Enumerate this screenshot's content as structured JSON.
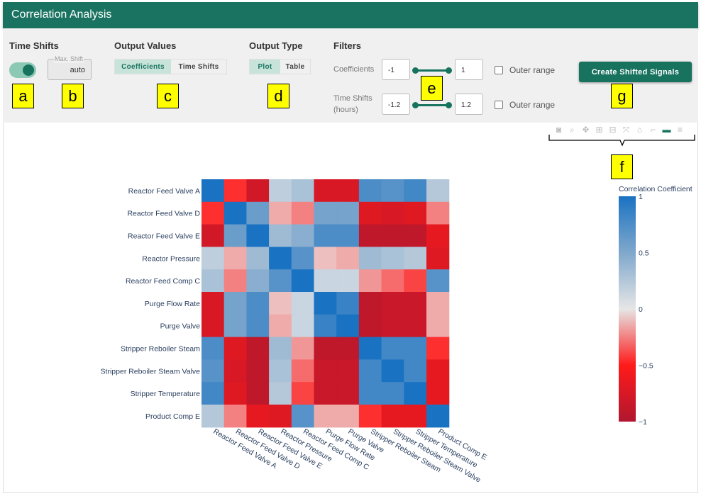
{
  "header": {
    "title": "Correlation Analysis"
  },
  "controls": {
    "time_shifts": {
      "title": "Time Shifts",
      "toggle_on": true,
      "max_shift_label": "Max. Shift",
      "max_shift_value": "auto"
    },
    "output_values": {
      "title": "Output Values",
      "options": [
        "Coefficients",
        "Time Shifts"
      ],
      "selected": "Coefficients"
    },
    "output_type": {
      "title": "Output Type",
      "options": [
        "Plot",
        "Table"
      ],
      "selected": "Plot"
    },
    "filters": {
      "title": "Filters",
      "coefficients": {
        "label": "Coefficients",
        "min": "-1",
        "max": "1",
        "outer_label": "Outer range"
      },
      "time_shifts": {
        "label_line1": "Time Shifts",
        "label_line2": "(hours)",
        "min": "-1.2",
        "max": "1.2",
        "outer_label": "Outer range"
      }
    },
    "create_button": "Create Shifted Signals"
  },
  "callouts": {
    "a": "a",
    "b": "b",
    "c": "c",
    "d": "d",
    "e": "e",
    "f": "f",
    "g": "g"
  },
  "modebar_icons": [
    "camera-icon",
    "zoom-icon",
    "pan-icon",
    "zoom-in-icon",
    "zoom-out-icon",
    "autoscale-icon",
    "home-icon",
    "spike-lines-icon",
    "toggle-icon",
    "compare-icon"
  ],
  "chart_data": {
    "type": "heatmap",
    "x": [
      "Reactor Feed Valve A",
      "Reactor Feed Valve D",
      "Reactor Feed Valve E",
      "Reactor Pressure",
      "Reactor Feed Comp C",
      "Purge Flow Rate",
      "Purge Valve",
      "Stripper Reboiler Steam",
      "Stripper Reboiler Steam Valve",
      "Stripper Temperature",
      "Product Comp E"
    ],
    "y": [
      "Reactor Feed Valve A",
      "Reactor Feed Valve D",
      "Reactor Feed Valve E",
      "Reactor Pressure",
      "Reactor Feed Comp C",
      "Purge Flow Rate",
      "Purge Valve",
      "Stripper Reboiler Steam",
      "Stripper Reboiler Steam Valve",
      "Stripper Temperature",
      "Product Comp E"
    ],
    "z": [
      [
        1,
        -0.45,
        -0.8,
        0.2,
        0.3,
        -0.75,
        -0.75,
        0.75,
        0.7,
        0.8,
        0.25
      ],
      [
        -0.45,
        1,
        0.6,
        -0.15,
        -0.25,
        0.55,
        0.55,
        -0.7,
        -0.75,
        -0.7,
        -0.25
      ],
      [
        -0.8,
        0.6,
        1,
        0.35,
        0.45,
        0.75,
        0.75,
        -0.9,
        -0.9,
        -0.9,
        -0.65
      ],
      [
        0.2,
        -0.15,
        0.35,
        1,
        0.7,
        -0.1,
        -0.15,
        0.35,
        0.3,
        0.25,
        -0.7
      ],
      [
        0.3,
        -0.25,
        0.45,
        0.7,
        1,
        0.15,
        0.15,
        -0.2,
        -0.3,
        -0.4,
        0.7
      ],
      [
        -0.75,
        0.55,
        0.75,
        -0.1,
        0.15,
        1,
        0.85,
        -0.9,
        -0.85,
        -0.85,
        -0.15
      ],
      [
        -0.75,
        0.55,
        0.75,
        -0.15,
        0.15,
        0.85,
        1,
        -0.9,
        -0.85,
        -0.85,
        -0.15
      ],
      [
        0.75,
        -0.7,
        -0.9,
        0.35,
        -0.2,
        -0.9,
        -0.9,
        1,
        0.8,
        0.8,
        -0.45
      ],
      [
        0.7,
        -0.75,
        -0.9,
        0.3,
        -0.3,
        -0.85,
        -0.85,
        0.8,
        1,
        0.8,
        -0.65
      ],
      [
        0.8,
        -0.7,
        -0.9,
        0.25,
        -0.4,
        -0.85,
        -0.85,
        0.8,
        0.8,
        1,
        -0.65
      ],
      [
        0.25,
        -0.25,
        -0.65,
        -0.7,
        0.7,
        -0.15,
        -0.15,
        -0.45,
        -0.65,
        -0.65,
        1
      ]
    ],
    "zlim": [
      -1,
      1
    ],
    "colorbar": {
      "title": "Correlation Coefficient",
      "ticks": [
        1,
        0.5,
        0,
        -0.5,
        -1
      ],
      "tick_labels": [
        "1",
        "0.5",
        "0",
        "−0.5",
        "−1"
      ]
    }
  }
}
